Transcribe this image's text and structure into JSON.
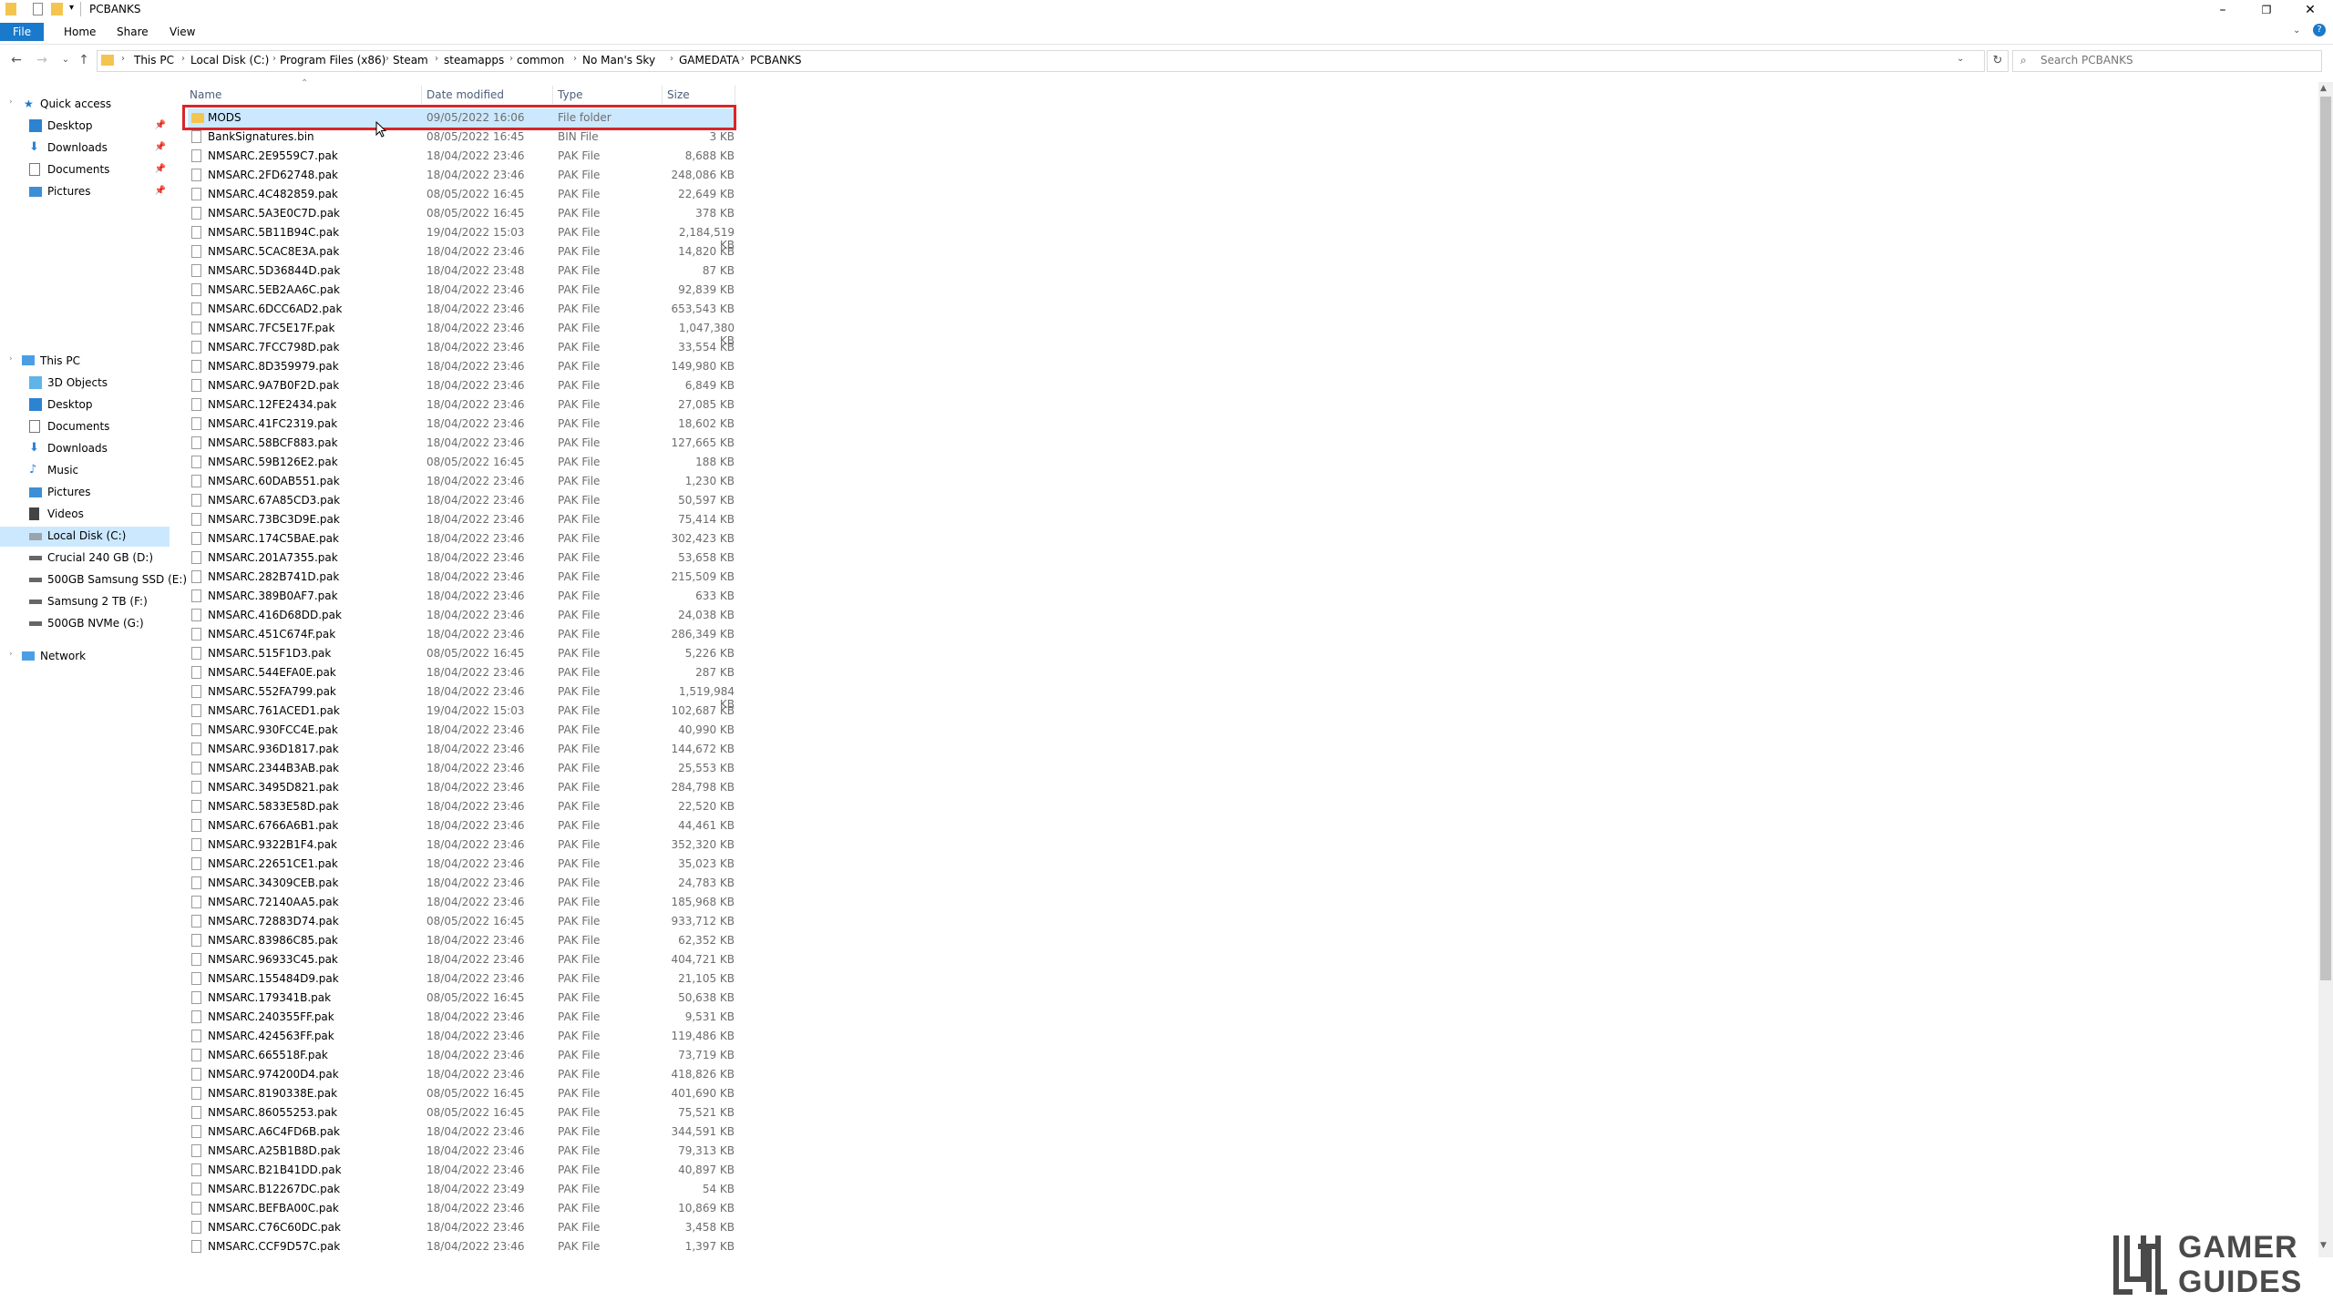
{
  "window": {
    "title": "PCBANKS",
    "controls": [
      "minimize",
      "restore",
      "close"
    ]
  },
  "ribbon": {
    "tabs": [
      "File",
      "Home",
      "Share",
      "View"
    ]
  },
  "address": {
    "crumbs": [
      "This PC",
      "Local Disk (C:)",
      "Program Files (x86)",
      "Steam",
      "steamapps",
      "common",
      "No Man's Sky",
      "GAMEDATA",
      "PCBANKS"
    ],
    "search_placeholder": "Search PCBANKS"
  },
  "nav": {
    "quick_access": {
      "label": "Quick access",
      "items": [
        "Desktop",
        "Downloads",
        "Documents",
        "Pictures"
      ]
    },
    "this_pc": {
      "label": "This PC",
      "items": [
        "3D Objects",
        "Desktop",
        "Documents",
        "Downloads",
        "Music",
        "Pictures",
        "Videos",
        "Local Disk (C:)",
        "Crucial 240 GB (D:)",
        "500GB Samsung SSD (E:)",
        "Samsung 2 TB (F:)",
        "500GB NVMe (G:)"
      ],
      "selected": "Local Disk (C:)"
    },
    "network": "Network"
  },
  "columns": {
    "name": "Name",
    "date": "Date modified",
    "type": "Type",
    "size": "Size"
  },
  "files": [
    {
      "name": "MODS",
      "date": "09/05/2022 16:06",
      "type": "File folder",
      "size": "",
      "folder": true,
      "selected": true
    },
    {
      "name": "BankSignatures.bin",
      "date": "08/05/2022 16:45",
      "type": "BIN File",
      "size": "3 KB"
    },
    {
      "name": "NMSARC.2E9559C7.pak",
      "date": "18/04/2022 23:46",
      "type": "PAK File",
      "size": "8,688 KB"
    },
    {
      "name": "NMSARC.2FD62748.pak",
      "date": "18/04/2022 23:46",
      "type": "PAK File",
      "size": "248,086 KB"
    },
    {
      "name": "NMSARC.4C482859.pak",
      "date": "08/05/2022 16:45",
      "type": "PAK File",
      "size": "22,649 KB"
    },
    {
      "name": "NMSARC.5A3E0C7D.pak",
      "date": "08/05/2022 16:45",
      "type": "PAK File",
      "size": "378 KB"
    },
    {
      "name": "NMSARC.5B11B94C.pak",
      "date": "19/04/2022 15:03",
      "type": "PAK File",
      "size": "2,184,519 KB"
    },
    {
      "name": "NMSARC.5CAC8E3A.pak",
      "date": "18/04/2022 23:46",
      "type": "PAK File",
      "size": "14,820 KB"
    },
    {
      "name": "NMSARC.5D36844D.pak",
      "date": "18/04/2022 23:48",
      "type": "PAK File",
      "size": "87 KB"
    },
    {
      "name": "NMSARC.5EB2AA6C.pak",
      "date": "18/04/2022 23:46",
      "type": "PAK File",
      "size": "92,839 KB"
    },
    {
      "name": "NMSARC.6DCC6AD2.pak",
      "date": "18/04/2022 23:46",
      "type": "PAK File",
      "size": "653,543 KB"
    },
    {
      "name": "NMSARC.7FC5E17F.pak",
      "date": "18/04/2022 23:46",
      "type": "PAK File",
      "size": "1,047,380 KB"
    },
    {
      "name": "NMSARC.7FCC798D.pak",
      "date": "18/04/2022 23:46",
      "type": "PAK File",
      "size": "33,554 KB"
    },
    {
      "name": "NMSARC.8D359979.pak",
      "date": "18/04/2022 23:46",
      "type": "PAK File",
      "size": "149,980 KB"
    },
    {
      "name": "NMSARC.9A7B0F2D.pak",
      "date": "18/04/2022 23:46",
      "type": "PAK File",
      "size": "6,849 KB"
    },
    {
      "name": "NMSARC.12FE2434.pak",
      "date": "18/04/2022 23:46",
      "type": "PAK File",
      "size": "27,085 KB"
    },
    {
      "name": "NMSARC.41FC2319.pak",
      "date": "18/04/2022 23:46",
      "type": "PAK File",
      "size": "18,602 KB"
    },
    {
      "name": "NMSARC.58BCF883.pak",
      "date": "18/04/2022 23:46",
      "type": "PAK File",
      "size": "127,665 KB"
    },
    {
      "name": "NMSARC.59B126E2.pak",
      "date": "08/05/2022 16:45",
      "type": "PAK File",
      "size": "188 KB"
    },
    {
      "name": "NMSARC.60DAB551.pak",
      "date": "18/04/2022 23:46",
      "type": "PAK File",
      "size": "1,230 KB"
    },
    {
      "name": "NMSARC.67A85CD3.pak",
      "date": "18/04/2022 23:46",
      "type": "PAK File",
      "size": "50,597 KB"
    },
    {
      "name": "NMSARC.73BC3D9E.pak",
      "date": "18/04/2022 23:46",
      "type": "PAK File",
      "size": "75,414 KB"
    },
    {
      "name": "NMSARC.174C5BAE.pak",
      "date": "18/04/2022 23:46",
      "type": "PAK File",
      "size": "302,423 KB"
    },
    {
      "name": "NMSARC.201A7355.pak",
      "date": "18/04/2022 23:46",
      "type": "PAK File",
      "size": "53,658 KB"
    },
    {
      "name": "NMSARC.282B741D.pak",
      "date": "18/04/2022 23:46",
      "type": "PAK File",
      "size": "215,509 KB"
    },
    {
      "name": "NMSARC.389B0AF7.pak",
      "date": "18/04/2022 23:46",
      "type": "PAK File",
      "size": "633 KB"
    },
    {
      "name": "NMSARC.416D68DD.pak",
      "date": "18/04/2022 23:46",
      "type": "PAK File",
      "size": "24,038 KB"
    },
    {
      "name": "NMSARC.451C674F.pak",
      "date": "18/04/2022 23:46",
      "type": "PAK File",
      "size": "286,349 KB"
    },
    {
      "name": "NMSARC.515F1D3.pak",
      "date": "08/05/2022 16:45",
      "type": "PAK File",
      "size": "5,226 KB"
    },
    {
      "name": "NMSARC.544EFA0E.pak",
      "date": "18/04/2022 23:46",
      "type": "PAK File",
      "size": "287 KB"
    },
    {
      "name": "NMSARC.552FA799.pak",
      "date": "18/04/2022 23:46",
      "type": "PAK File",
      "size": "1,519,984 KB"
    },
    {
      "name": "NMSARC.761ACED1.pak",
      "date": "19/04/2022 15:03",
      "type": "PAK File",
      "size": "102,687 KB"
    },
    {
      "name": "NMSARC.930FCC4E.pak",
      "date": "18/04/2022 23:46",
      "type": "PAK File",
      "size": "40,990 KB"
    },
    {
      "name": "NMSARC.936D1817.pak",
      "date": "18/04/2022 23:46",
      "type": "PAK File",
      "size": "144,672 KB"
    },
    {
      "name": "NMSARC.2344B3AB.pak",
      "date": "18/04/2022 23:46",
      "type": "PAK File",
      "size": "25,553 KB"
    },
    {
      "name": "NMSARC.3495D821.pak",
      "date": "18/04/2022 23:46",
      "type": "PAK File",
      "size": "284,798 KB"
    },
    {
      "name": "NMSARC.5833E58D.pak",
      "date": "18/04/2022 23:46",
      "type": "PAK File",
      "size": "22,520 KB"
    },
    {
      "name": "NMSARC.6766A6B1.pak",
      "date": "18/04/2022 23:46",
      "type": "PAK File",
      "size": "44,461 KB"
    },
    {
      "name": "NMSARC.9322B1F4.pak",
      "date": "18/04/2022 23:46",
      "type": "PAK File",
      "size": "352,320 KB"
    },
    {
      "name": "NMSARC.22651CE1.pak",
      "date": "18/04/2022 23:46",
      "type": "PAK File",
      "size": "35,023 KB"
    },
    {
      "name": "NMSARC.34309CEB.pak",
      "date": "18/04/2022 23:46",
      "type": "PAK File",
      "size": "24,783 KB"
    },
    {
      "name": "NMSARC.72140AA5.pak",
      "date": "18/04/2022 23:46",
      "type": "PAK File",
      "size": "185,968 KB"
    },
    {
      "name": "NMSARC.72883D74.pak",
      "date": "08/05/2022 16:45",
      "type": "PAK File",
      "size": "933,712 KB"
    },
    {
      "name": "NMSARC.83986C85.pak",
      "date": "18/04/2022 23:46",
      "type": "PAK File",
      "size": "62,352 KB"
    },
    {
      "name": "NMSARC.96933C45.pak",
      "date": "18/04/2022 23:46",
      "type": "PAK File",
      "size": "404,721 KB"
    },
    {
      "name": "NMSARC.155484D9.pak",
      "date": "18/04/2022 23:46",
      "type": "PAK File",
      "size": "21,105 KB"
    },
    {
      "name": "NMSARC.179341B.pak",
      "date": "08/05/2022 16:45",
      "type": "PAK File",
      "size": "50,638 KB"
    },
    {
      "name": "NMSARC.240355FF.pak",
      "date": "18/04/2022 23:46",
      "type": "PAK File",
      "size": "9,531 KB"
    },
    {
      "name": "NMSARC.424563FF.pak",
      "date": "18/04/2022 23:46",
      "type": "PAK File",
      "size": "119,486 KB"
    },
    {
      "name": "NMSARC.665518F.pak",
      "date": "18/04/2022 23:46",
      "type": "PAK File",
      "size": "73,719 KB"
    },
    {
      "name": "NMSARC.974200D4.pak",
      "date": "18/04/2022 23:46",
      "type": "PAK File",
      "size": "418,826 KB"
    },
    {
      "name": "NMSARC.8190338E.pak",
      "date": "08/05/2022 16:45",
      "type": "PAK File",
      "size": "401,690 KB"
    },
    {
      "name": "NMSARC.86055253.pak",
      "date": "08/05/2022 16:45",
      "type": "PAK File",
      "size": "75,521 KB"
    },
    {
      "name": "NMSARC.A6C4FD6B.pak",
      "date": "18/04/2022 23:46",
      "type": "PAK File",
      "size": "344,591 KB"
    },
    {
      "name": "NMSARC.A25B1B8D.pak",
      "date": "18/04/2022 23:46",
      "type": "PAK File",
      "size": "79,313 KB"
    },
    {
      "name": "NMSARC.B21B41DD.pak",
      "date": "18/04/2022 23:46",
      "type": "PAK File",
      "size": "40,897 KB"
    },
    {
      "name": "NMSARC.B12267DC.pak",
      "date": "18/04/2022 23:49",
      "type": "PAK File",
      "size": "54 KB"
    },
    {
      "name": "NMSARC.BEFBA00C.pak",
      "date": "18/04/2022 23:46",
      "type": "PAK File",
      "size": "10,869 KB"
    },
    {
      "name": "NMSARC.C76C60DC.pak",
      "date": "18/04/2022 23:46",
      "type": "PAK File",
      "size": "3,458 KB"
    },
    {
      "name": "NMSARC.CCF9D57C.pak",
      "date": "18/04/2022 23:46",
      "type": "PAK File",
      "size": "1,397 KB"
    }
  ],
  "colors": {
    "selection": "#cce8ff",
    "highlight_box": "#d9252a",
    "accent": "#1979ca"
  },
  "watermark": {
    "line1": "GAMER",
    "line2": "GUIDES"
  }
}
